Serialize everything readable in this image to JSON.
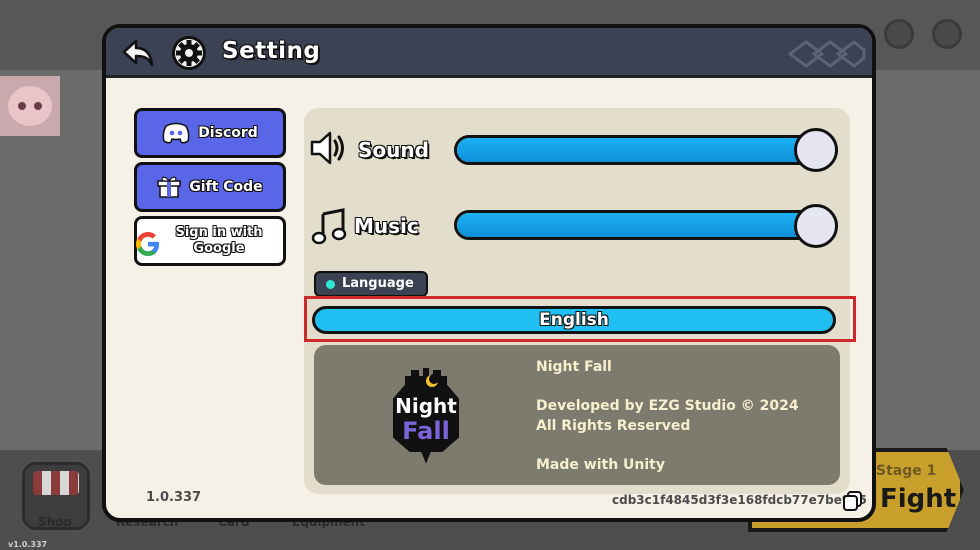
{
  "dialog": {
    "title": "Setting",
    "icons": {
      "back": "back-arrow-icon",
      "settings": "gear-icon"
    }
  },
  "sidebar": {
    "discord_label": "Discord",
    "gift_code_label": "Gift Code",
    "google_line1": "Sign in with",
    "google_line2": "Google",
    "version": "1.0.337"
  },
  "audio": {
    "sound_label": "Sound",
    "sound_level_percent": 100,
    "music_label": "Music",
    "music_level_percent": 100
  },
  "language": {
    "tag_label": "Language",
    "selected": "English"
  },
  "info": {
    "game_name": "Night Fall",
    "developer": "Developed by EZG Studio © 2024",
    "rights": "All Rights Reserved",
    "engine": "Made with Unity",
    "logo_line1": "Night",
    "logo_line2": "Fall"
  },
  "footer": {
    "hash": "cdb3c1f4845d3f3e168fdcb77e7be945"
  },
  "background": {
    "nav": {
      "shop": "Shop",
      "research": "Research",
      "card": "Card",
      "equipment": "Equipment"
    },
    "version_tiny": "v1.0.337",
    "stage_label": "Stage 1",
    "fight_label": "Fight"
  },
  "colors": {
    "header_bg": "#3b4253",
    "discord_blue": "#5a66e8",
    "slider_blue": "#1db2f4",
    "highlight_red": "#cc2a2a",
    "dialog_bg": "#f5f1e6",
    "info_bg": "#7d7a6e"
  }
}
